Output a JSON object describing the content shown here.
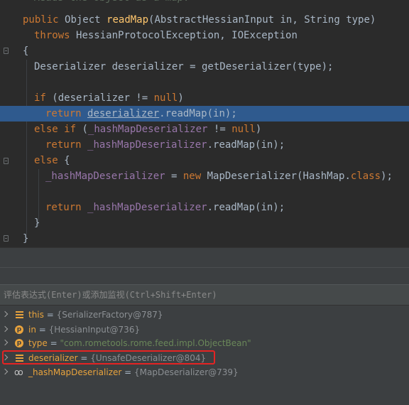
{
  "editor": {
    "partial_comment": "Reads the object as a map.",
    "lines": {
      "l1": {
        "kw": "public",
        "plain1": "Object",
        "fn": "readMap",
        "plain2": "(AbstractHessianInput in, String type)"
      },
      "l2": {
        "kw": "throws",
        "plain": "HessianProtocolException, IOException"
      },
      "l3": {
        "plain": "{"
      },
      "l4": {
        "plain": "Deserializer deserializer = getDeserializer(type);"
      },
      "l5": {
        "kw1": "if",
        "plain": "(deserializer != ",
        "kw2": "null",
        "plain2": ")"
      },
      "l6": {
        "kw": "return",
        "ul": "deserializer",
        "plain": ".readMap(in);"
      },
      "l7": {
        "kw1": "else if",
        "plain": "(",
        "fld": "_hashMapDeserializer",
        "plain2": " != ",
        "kw2": "null",
        "plain3": ")"
      },
      "l8": {
        "kw": "return",
        "fld": "_hashMapDeserializer",
        "plain": ".readMap(in);"
      },
      "l9": {
        "kw": "else",
        "plain": "{"
      },
      "l10": {
        "fld": "_hashMapDeserializer",
        "plain1": " = ",
        "kw1": "new",
        "plain2": " MapDeserializer(HashMap.",
        "kw2": "class",
        "plain3": ");"
      },
      "l11": {
        "kw": "return",
        "fld": "_hashMapDeserializer",
        "plain": ".readMap(in);"
      },
      "l12": {
        "plain": "}"
      },
      "l13": {
        "plain": "}"
      }
    }
  },
  "evaluate": {
    "placeholder": "评估表达式(Enter)或添加监视(Ctrl+Shift+Enter)"
  },
  "variables": [
    {
      "icon": "field-icon",
      "name": "this",
      "eq": " = ",
      "value": "{SerializerFactory@787}"
    },
    {
      "icon": "param-icon",
      "icon_glyph": "p",
      "name": "in",
      "eq": " = ",
      "value": "{HessianInput@736}"
    },
    {
      "icon": "param-icon",
      "icon_glyph": "p",
      "name": "type",
      "eq": " = ",
      "value": "\"com.rometools.rome.feed.impl.ObjectBean\""
    },
    {
      "icon": "field-icon",
      "name": "deserializer",
      "eq": " = ",
      "value": "{UnsafeDeserializer@804}"
    },
    {
      "icon": "watch-icon",
      "icon_glyph": "oo",
      "name": "_hashMapDeserializer",
      "eq": " = ",
      "value": "{MapDeserializer@739}"
    }
  ],
  "colors": {
    "editor_bg": "#2b2b2b",
    "current_line": "#2f5a8e",
    "keyword": "#cc7832",
    "function": "#ffc66d",
    "field": "#9876aa",
    "panel_bg": "#3c3f41",
    "highlight_border": "#e52323"
  }
}
